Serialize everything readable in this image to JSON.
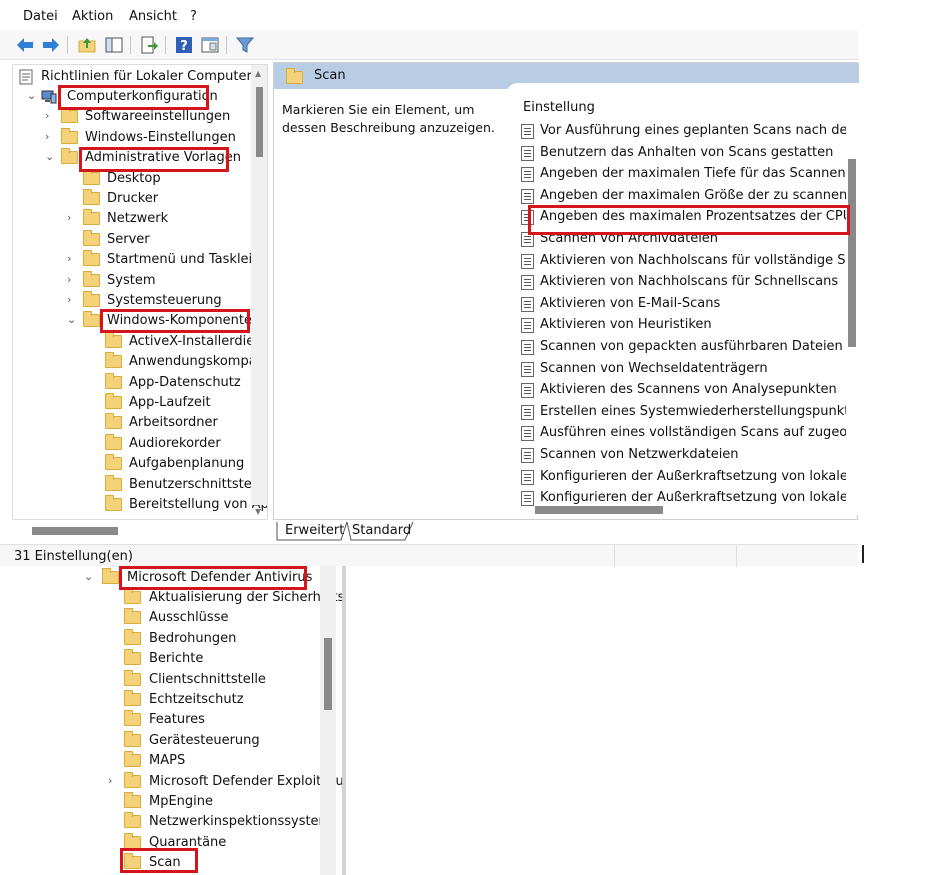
{
  "menu": [
    "Datei",
    "Aktion",
    "Ansicht",
    "?"
  ],
  "colors": {
    "highlight": "#d4161c",
    "header_bar": "#b8cde3",
    "folder": "#f3d27a"
  },
  "toolbar_icons": [
    "back-arrow-icon",
    "forward-arrow-icon",
    "up-folder-icon",
    "show-tree-icon",
    "export-icon",
    "help-icon",
    "properties-icon",
    "filter-icon"
  ],
  "tree": {
    "root": "Richtlinien für Lokaler Computer",
    "items": [
      {
        "label": "Computerkonfiguration",
        "chev": "⌄"
      },
      {
        "label": "Softwareeinstellungen",
        "chev": "›"
      },
      {
        "label": "Windows-Einstellungen",
        "chev": "›"
      },
      {
        "label": "Administrative Vorlagen",
        "chev": "⌄"
      },
      {
        "label": "Desktop",
        "chev": ""
      },
      {
        "label": "Drucker",
        "chev": ""
      },
      {
        "label": "Netzwerk",
        "chev": "›"
      },
      {
        "label": "Server",
        "chev": ""
      },
      {
        "label": "Startmenü und Taskleiste",
        "chev": "›"
      },
      {
        "label": "System",
        "chev": "›"
      },
      {
        "label": "Systemsteuerung",
        "chev": "›"
      },
      {
        "label": "Windows-Komponenten",
        "chev": "⌄"
      },
      {
        "label": "ActiveX-Installerdienst",
        "chev": ""
      },
      {
        "label": "Anwendungskompatibilität",
        "chev": ""
      },
      {
        "label": "App-Datenschutz",
        "chev": ""
      },
      {
        "label": "App-Laufzeit",
        "chev": ""
      },
      {
        "label": "Arbeitsordner",
        "chev": ""
      },
      {
        "label": "Audiorekorder",
        "chev": ""
      },
      {
        "label": "Aufgabenplanung",
        "chev": ""
      },
      {
        "label": "Benutzerschnittstelle",
        "chev": ""
      },
      {
        "label": "Bereitstellung von Apps",
        "chev": ""
      }
    ]
  },
  "right_pane": {
    "header": "Scan",
    "description": "Markieren Sie ein Element, um dessen Beschreibung anzuzeigen.",
    "column_header": "Einstellung",
    "settings": [
      "Vor Ausführung eines geplanten Scans nach den neuesten",
      "Benutzern das Anhalten von Scans gestatten",
      "Angeben der maximalen Tiefe für das Scannen von Archivdateien",
      "Angeben der maximalen Größe der zu scannenden Archivdateien",
      "Angeben des maximalen Prozentsatzes der CPU-Auslastung",
      "Scannen von Archivdateien",
      "Aktivieren von Nachholscans für vollständige Scans",
      "Aktivieren von Nachholscans für Schnellscans",
      "Aktivieren von E-Mail-Scans",
      "Aktivieren von Heuristiken",
      "Scannen von gepackten ausführbaren Dateien",
      "Scannen von Wechseldatenträgern",
      "Aktivieren des Scannens von Analysepunkten",
      "Erstellen eines Systemwiederherstellungspunkts",
      "Ausführen eines vollständigen Scans auf zugeordneten Netzlaufwerken",
      "Scannen von Netzwerkdateien",
      "Konfigurieren der Außerkraftsetzung von lokalen Einstellungen",
      "Konfigurieren der Außerkraftsetzung von lokalen Einstellungen"
    ]
  },
  "tabs": [
    "Erweitert",
    "Standard"
  ],
  "status": "31 Einstellung(en)",
  "tree2": {
    "parent": "Microsoft Defender Antivirus",
    "items": [
      {
        "label": "Aktualisierung der Sicherheitsinformationen",
        "chev": ""
      },
      {
        "label": "Ausschlüsse",
        "chev": ""
      },
      {
        "label": "Bedrohungen",
        "chev": ""
      },
      {
        "label": "Berichte",
        "chev": ""
      },
      {
        "label": "Clientschnittstelle",
        "chev": ""
      },
      {
        "label": "Echtzeitschutz",
        "chev": ""
      },
      {
        "label": "Features",
        "chev": ""
      },
      {
        "label": "Gerätesteuerung",
        "chev": ""
      },
      {
        "label": "MAPS",
        "chev": ""
      },
      {
        "label": "Microsoft Defender Exploit Guard",
        "chev": "›"
      },
      {
        "label": "MpEngine",
        "chev": ""
      },
      {
        "label": "Netzwerkinspektionssystem",
        "chev": ""
      },
      {
        "label": "Quarantäne",
        "chev": ""
      },
      {
        "label": "Scan",
        "chev": ""
      }
    ]
  }
}
